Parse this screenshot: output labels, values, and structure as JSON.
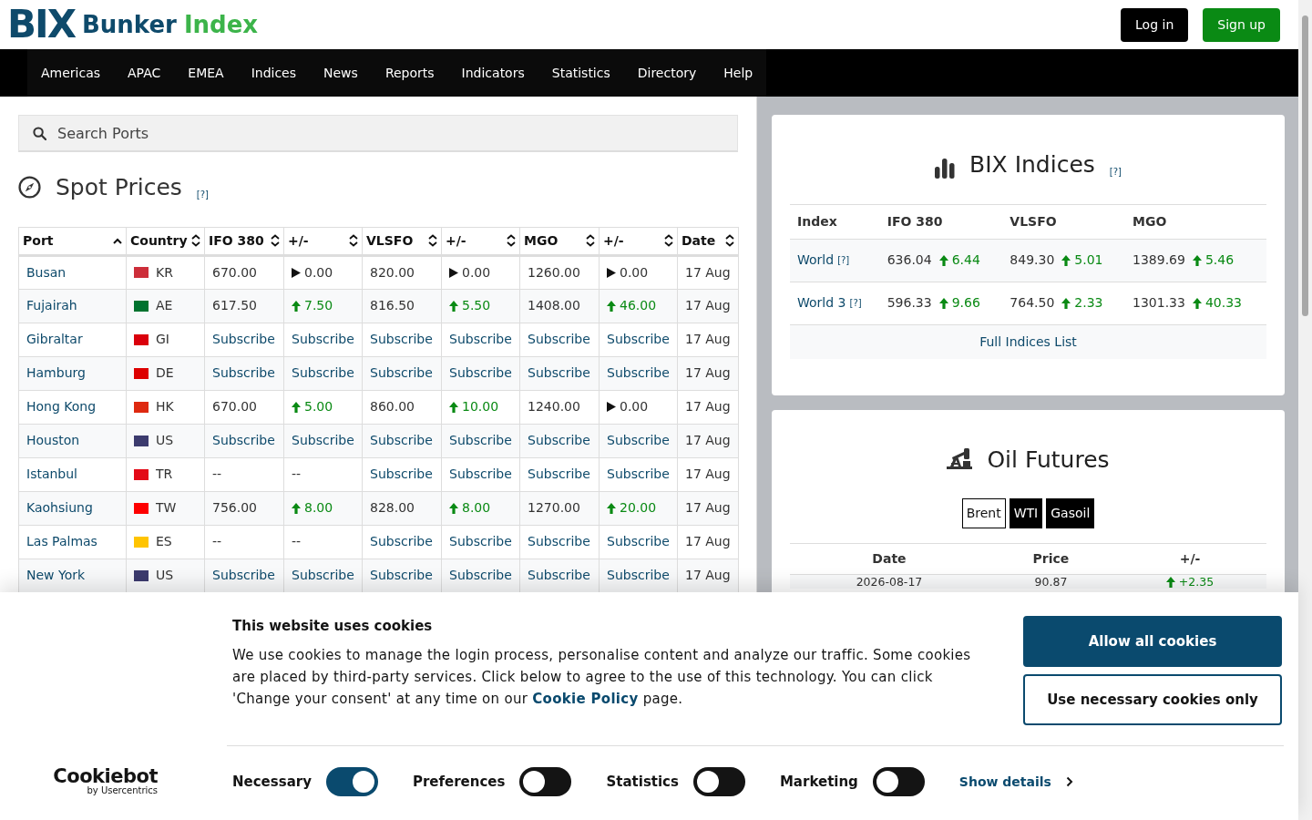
{
  "header": {
    "logo": {
      "mark": "BIX",
      "word1": "Bunker",
      "word2": "Index"
    },
    "buttons": [
      {
        "label": "Log in",
        "kind": "dark"
      },
      {
        "label": "Sign up",
        "kind": "success"
      }
    ]
  },
  "nav": {
    "items": [
      "Americas",
      "APAC",
      "EMEA",
      "Indices",
      "News",
      "Reports",
      "Indicators",
      "Statistics",
      "Directory",
      "Help"
    ]
  },
  "search": {
    "placeholder": "Search Ports"
  },
  "spot_prices": {
    "title": "Spot Prices",
    "help": "[?]",
    "columns": [
      {
        "label": "Port",
        "sorted": true
      },
      {
        "label": "Country",
        "sorted": false
      },
      {
        "label": "IFO 380",
        "sorted": false
      },
      {
        "label": "+/-",
        "sorted": false
      },
      {
        "label": "VLSFO",
        "sorted": false
      },
      {
        "label": "+/-",
        "sorted": false
      },
      {
        "label": "MGO",
        "sorted": false
      },
      {
        "label": "+/-",
        "sorted": false
      },
      {
        "label": "Date",
        "sorted": false
      }
    ],
    "rows": [
      {
        "cells": [
          {
            "text": "Busan",
            "kind": "port"
          },
          {
            "text": "KR",
            "kind": "country",
            "color": "#cd2e3a"
          },
          {
            "text": "670.00",
            "kind": "price"
          },
          {
            "text": "0.00",
            "kind": "flat"
          },
          {
            "text": "820.00",
            "kind": "price"
          },
          {
            "text": "0.00",
            "kind": "flat"
          },
          {
            "text": "1260.00",
            "kind": "price"
          },
          {
            "text": "0.00",
            "kind": "flat"
          },
          {
            "text": "17 Aug",
            "kind": "date"
          }
        ]
      },
      {
        "cells": [
          {
            "text": "Fujairah",
            "kind": "port"
          },
          {
            "text": "AE",
            "kind": "country",
            "color": "#00732f"
          },
          {
            "text": "617.50",
            "kind": "price"
          },
          {
            "text": "7.50",
            "kind": "up"
          },
          {
            "text": "816.50",
            "kind": "price"
          },
          {
            "text": "5.50",
            "kind": "up"
          },
          {
            "text": "1408.00",
            "kind": "price"
          },
          {
            "text": "46.00",
            "kind": "up"
          },
          {
            "text": "17 Aug",
            "kind": "date"
          }
        ]
      },
      {
        "cells": [
          {
            "text": "Gibraltar",
            "kind": "port"
          },
          {
            "text": "GI",
            "kind": "country",
            "color": "#da000c"
          },
          {
            "text": "Subscribe",
            "kind": "link"
          },
          {
            "text": "Subscribe",
            "kind": "link"
          },
          {
            "text": "Subscribe",
            "kind": "link"
          },
          {
            "text": "Subscribe",
            "kind": "link"
          },
          {
            "text": "Subscribe",
            "kind": "link"
          },
          {
            "text": "Subscribe",
            "kind": "link"
          },
          {
            "text": "17 Aug",
            "kind": "date"
          }
        ]
      },
      {
        "cells": [
          {
            "text": "Hamburg",
            "kind": "port"
          },
          {
            "text": "DE",
            "kind": "country",
            "color": "#dd0000"
          },
          {
            "text": "Subscribe",
            "kind": "link"
          },
          {
            "text": "Subscribe",
            "kind": "link"
          },
          {
            "text": "Subscribe",
            "kind": "link"
          },
          {
            "text": "Subscribe",
            "kind": "link"
          },
          {
            "text": "Subscribe",
            "kind": "link"
          },
          {
            "text": "Subscribe",
            "kind": "link"
          },
          {
            "text": "17 Aug",
            "kind": "date"
          }
        ]
      },
      {
        "cells": [
          {
            "text": "Hong Kong",
            "kind": "port"
          },
          {
            "text": "HK",
            "kind": "country",
            "color": "#de2910"
          },
          {
            "text": "670.00",
            "kind": "price"
          },
          {
            "text": "5.00",
            "kind": "up"
          },
          {
            "text": "860.00",
            "kind": "price"
          },
          {
            "text": "10.00",
            "kind": "up"
          },
          {
            "text": "1240.00",
            "kind": "price"
          },
          {
            "text": "0.00",
            "kind": "flat"
          },
          {
            "text": "17 Aug",
            "kind": "date"
          }
        ]
      },
      {
        "cells": [
          {
            "text": "Houston",
            "kind": "port"
          },
          {
            "text": "US",
            "kind": "country",
            "color": "#3c3b6e"
          },
          {
            "text": "Subscribe",
            "kind": "link"
          },
          {
            "text": "Subscribe",
            "kind": "link"
          },
          {
            "text": "Subscribe",
            "kind": "link"
          },
          {
            "text": "Subscribe",
            "kind": "link"
          },
          {
            "text": "Subscribe",
            "kind": "link"
          },
          {
            "text": "Subscribe",
            "kind": "link"
          },
          {
            "text": "17 Aug",
            "kind": "date"
          }
        ]
      },
      {
        "cells": [
          {
            "text": "Istanbul",
            "kind": "port"
          },
          {
            "text": "TR",
            "kind": "country",
            "color": "#e30a17"
          },
          {
            "text": "--",
            "kind": "empty"
          },
          {
            "text": "--",
            "kind": "empty"
          },
          {
            "text": "Subscribe",
            "kind": "link"
          },
          {
            "text": "Subscribe",
            "kind": "link"
          },
          {
            "text": "Subscribe",
            "kind": "link"
          },
          {
            "text": "Subscribe",
            "kind": "link"
          },
          {
            "text": "17 Aug",
            "kind": "date"
          }
        ]
      },
      {
        "cells": [
          {
            "text": "Kaohsiung",
            "kind": "port"
          },
          {
            "text": "TW",
            "kind": "country",
            "color": "#fe0000"
          },
          {
            "text": "756.00",
            "kind": "price"
          },
          {
            "text": "8.00",
            "kind": "up"
          },
          {
            "text": "828.00",
            "kind": "price"
          },
          {
            "text": "8.00",
            "kind": "up"
          },
          {
            "text": "1270.00",
            "kind": "price"
          },
          {
            "text": "20.00",
            "kind": "up"
          },
          {
            "text": "17 Aug",
            "kind": "date"
          }
        ]
      },
      {
        "cells": [
          {
            "text": "Las Palmas",
            "kind": "port"
          },
          {
            "text": "ES",
            "kind": "country",
            "color": "#ffc400"
          },
          {
            "text": "--",
            "kind": "empty"
          },
          {
            "text": "--",
            "kind": "empty"
          },
          {
            "text": "Subscribe",
            "kind": "link"
          },
          {
            "text": "Subscribe",
            "kind": "link"
          },
          {
            "text": "Subscribe",
            "kind": "link"
          },
          {
            "text": "Subscribe",
            "kind": "link"
          },
          {
            "text": "17 Aug",
            "kind": "date"
          }
        ]
      },
      {
        "cells": [
          {
            "text": "New York",
            "kind": "port"
          },
          {
            "text": "US",
            "kind": "country",
            "color": "#3c3b6e"
          },
          {
            "text": "Subscribe",
            "kind": "link"
          },
          {
            "text": "Subscribe",
            "kind": "link"
          },
          {
            "text": "Subscribe",
            "kind": "link"
          },
          {
            "text": "Subscribe",
            "kind": "link"
          },
          {
            "text": "Subscribe",
            "kind": "link"
          },
          {
            "text": "Subscribe",
            "kind": "link"
          },
          {
            "text": "17 Aug",
            "kind": "date"
          }
        ]
      }
    ]
  },
  "bix_indices": {
    "title": "BIX Indices",
    "help": "[?]",
    "columns": [
      "Index",
      "IFO 380",
      "VLSFO",
      "MGO"
    ],
    "rows": [
      {
        "name": "World",
        "help": "[?]",
        "values": [
          {
            "price": "636.04",
            "change": "6.44",
            "kind": "up"
          },
          {
            "price": "849.30",
            "change": "5.01",
            "kind": "up"
          },
          {
            "price": "1389.69",
            "change": "5.46",
            "kind": "up"
          }
        ]
      },
      {
        "name": "World 3",
        "help": "[?]",
        "values": [
          {
            "price": "596.33",
            "change": "9.66",
            "kind": "up"
          },
          {
            "price": "764.50",
            "change": "2.33",
            "kind": "up"
          },
          {
            "price": "1301.33",
            "change": "40.33",
            "kind": "up"
          }
        ]
      }
    ],
    "footer_link": "Full Indices List"
  },
  "oil_futures": {
    "title": "Oil Futures",
    "tabs": [
      {
        "label": "Brent",
        "selected": true
      },
      {
        "label": "WTI",
        "selected": false
      },
      {
        "label": "Gasoil",
        "selected": false
      }
    ],
    "columns": [
      "Date",
      "Price",
      "+/-"
    ],
    "rows": [
      {
        "date": "2026-08-17",
        "price": "90.87",
        "change": "+2.35",
        "kind": "up"
      }
    ]
  },
  "cookie_banner": {
    "title": "This website uses cookies",
    "text_before": "We use cookies to manage the login process, personalise content and analyze our traffic. Some cookies are placed by third-party services. Click below to agree to the use of this technology. You can click 'Change your consent' at any time on our ",
    "link": "Cookie Policy",
    "text_after": " page.",
    "buttons": [
      {
        "label": "Allow all cookies",
        "kind": "primary"
      },
      {
        "label": "Use necessary cookies only",
        "kind": "outline"
      }
    ],
    "brand": {
      "name": "Cookiebot",
      "tagline": "by Usercentrics"
    },
    "toggles": [
      {
        "label": "Necessary",
        "on": true
      },
      {
        "label": "Preferences",
        "on": false
      },
      {
        "label": "Statistics",
        "on": false
      },
      {
        "label": "Marketing",
        "on": false
      }
    ],
    "details_link": "Show details"
  }
}
